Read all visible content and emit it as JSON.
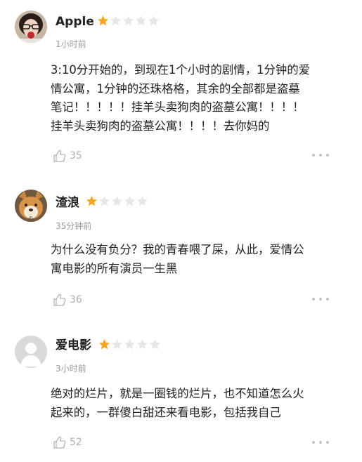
{
  "colors": {
    "star_filled": "#f5a623",
    "star_empty": "#e6e6e6"
  },
  "icons": {
    "like": "thumbs-up-outline-icon",
    "more": "ellipsis-icon"
  },
  "reviews": [
    {
      "username": "Apple",
      "rating": 1,
      "max_rating": 5,
      "time": "1小时前",
      "lines": [
        "3:10分开始的，到现在1个小时的剧情，1分钟的爱",
        "情公寓，1分钟的还珠格格，其余的全部都是盗墓",
        "笔记！！！！！挂羊头卖狗肉的盗墓公寓！！！！",
        "挂羊头卖狗肉的盗墓公寓！！！！去你妈的"
      ],
      "likes": "35"
    },
    {
      "username": "渣浪",
      "rating": 1,
      "max_rating": 5,
      "time": "35分钟前",
      "lines": [
        "为什么没有负分？我的青春喂了屎，从此，爱情公",
        "寓电影的所有演员一生黑"
      ],
      "likes": "36"
    },
    {
      "username": "爱电影",
      "rating": 1,
      "max_rating": 5,
      "time": "3小时前",
      "lines": [
        "绝对的烂片，就是一圈钱的烂片，也不知道怎么火",
        "起来的，一群傻白甜还来看电影，包括我自己"
      ],
      "likes": "52"
    }
  ]
}
